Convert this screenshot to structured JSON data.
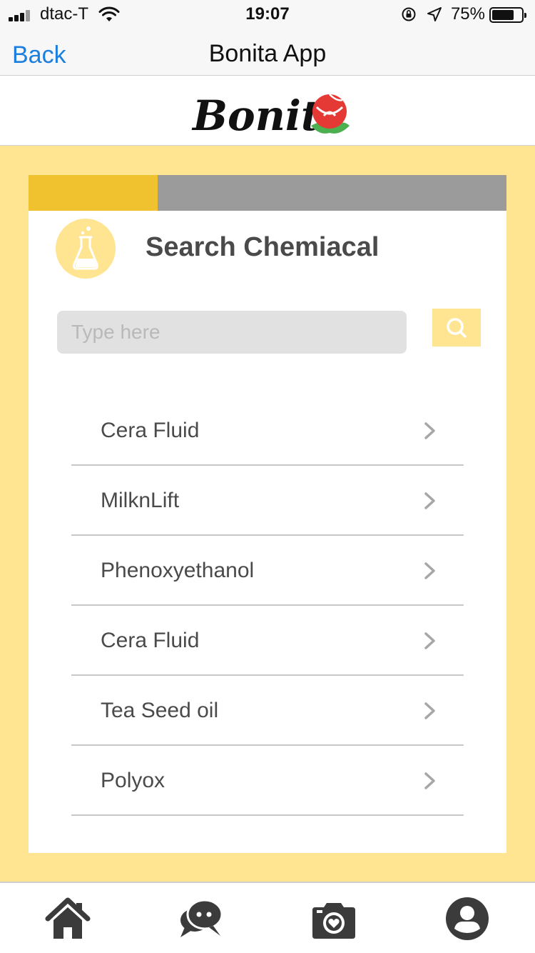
{
  "status_bar": {
    "carrier": "dtac-T",
    "time": "19:07",
    "battery_percent": "75%",
    "battery_level": 0.75,
    "icons": [
      "signal-icon",
      "wifi-icon",
      "rotation-lock-icon",
      "location-arrow-icon",
      "battery-icon"
    ]
  },
  "nav": {
    "back_label": "Back",
    "title": "Bonita App"
  },
  "logo": {
    "text": "Bonita",
    "icon": "rose-icon"
  },
  "colors": {
    "accent": "#f0c230",
    "light_yellow": "#ffe592",
    "progress_track": "#9b9b9b",
    "link_blue": "#1b7fe0",
    "text_dark": "#4a4a4a",
    "tab_icon": "#3b3b3b"
  },
  "progress": {
    "fraction": 0.27
  },
  "search": {
    "title": "Search Chemiacal",
    "header_icon": "flask-icon",
    "placeholder": "Type here",
    "value": "",
    "button_icon": "search-icon"
  },
  "chemicals": [
    {
      "label": "Cera Fluid"
    },
    {
      "label": "MilknLift"
    },
    {
      "label": "Phenoxyethanol"
    },
    {
      "label": "Cera Fluid"
    },
    {
      "label": "Tea Seed oil"
    },
    {
      "label": "Polyox"
    }
  ],
  "tabbar": {
    "tabs": [
      {
        "icon": "home-icon"
      },
      {
        "icon": "chat-icon"
      },
      {
        "icon": "camera-icon"
      },
      {
        "icon": "profile-icon"
      }
    ]
  }
}
